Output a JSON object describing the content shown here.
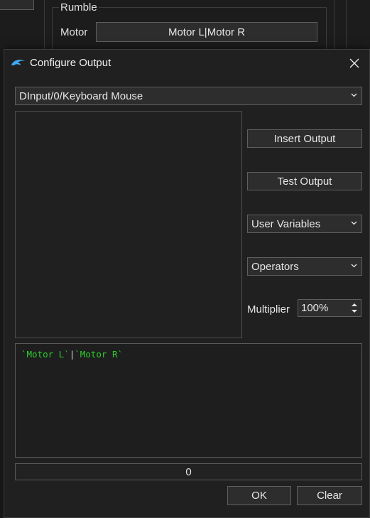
{
  "background": {
    "group_title": "Rumble",
    "motor_label": "Motor",
    "motor_binding": "Motor L|Motor R"
  },
  "dialog": {
    "title": "Configure Output",
    "app_icon": "dolphin-icon",
    "close_icon": "close-icon",
    "device": {
      "selected": "DInput/0/Keyboard Mouse"
    },
    "buttons": {
      "insert_output": "Insert Output",
      "test_output": "Test Output",
      "ok": "OK",
      "clear": "Clear"
    },
    "user_variables": {
      "selected": "User Variables"
    },
    "operators": {
      "selected": "Operators"
    },
    "multiplier": {
      "label": "Multiplier",
      "value": "100%"
    },
    "expression": {
      "token1": "`Motor L`",
      "operator": "|",
      "token2": "`Motor R`"
    },
    "result_value": "0",
    "colors": {
      "expression_token": "#2ecc2e",
      "background": "#202020",
      "control": "#2d2d2d"
    }
  }
}
